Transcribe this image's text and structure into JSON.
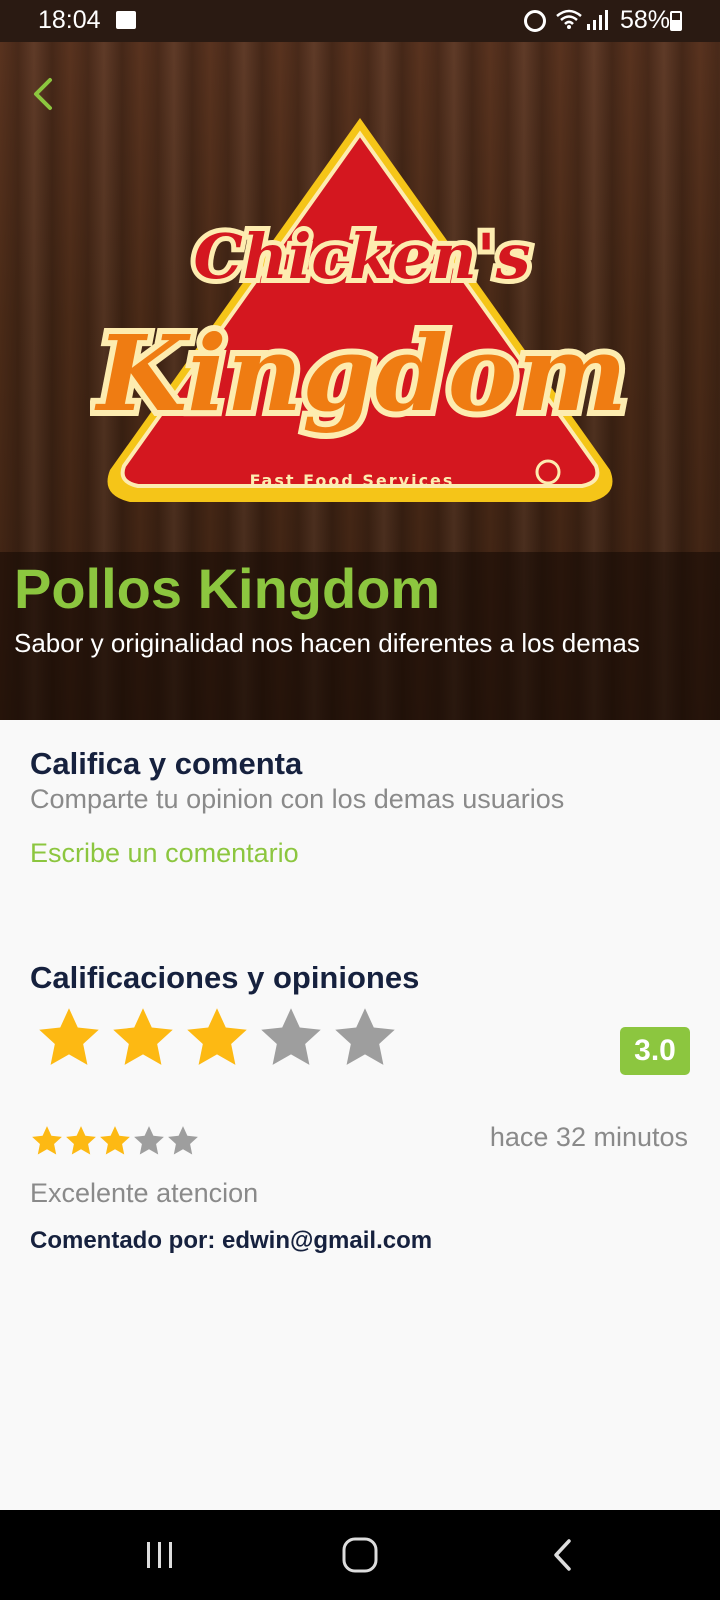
{
  "status_bar": {
    "time": "18:04",
    "battery": "58%",
    "icons": [
      "image-icon",
      "alarm-icon",
      "wifi-icon",
      "signal-icon",
      "battery-icon"
    ]
  },
  "hero": {
    "logo_text_line1": "Chicken's",
    "logo_text_line2": "Kingdom",
    "logo_text_line3": "Fast Food Services",
    "store_name": "Pollos Kingdom",
    "tagline": "Sabor y originalidad nos hacen diferentes a los demas"
  },
  "rate_section": {
    "title": "Califica y comenta",
    "subtitle": "Comparte tu opinion con los demas usuarios",
    "write_link": "Escribe un comentario"
  },
  "ratings_section": {
    "title": "Calificaciones y opiniones",
    "average_stars": 3,
    "max_stars": 5,
    "badge": "3.0"
  },
  "reviews": [
    {
      "stars": 3,
      "time": "hace 32 minutos",
      "text": "Excelente atencion",
      "author": "Comentado por: edwin@gmail.com"
    }
  ],
  "colors": {
    "accent": "#8cc63f",
    "title": "#16213e",
    "muted": "#8a8a8a",
    "star_on": "#fdb913",
    "star_off": "#9e9e9e"
  }
}
